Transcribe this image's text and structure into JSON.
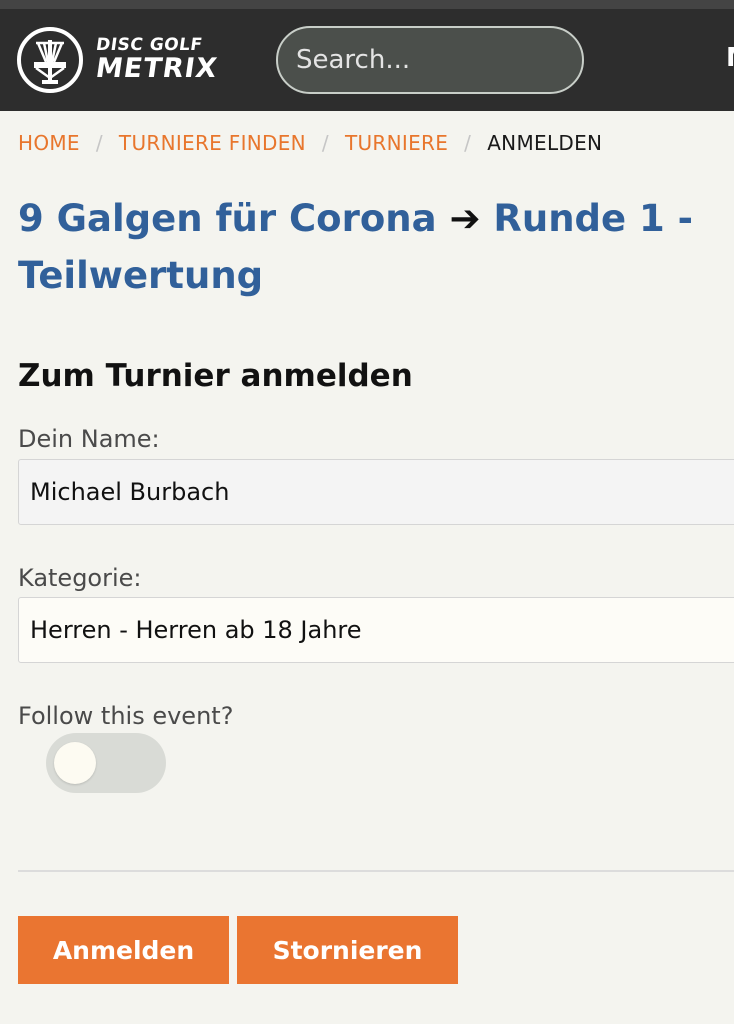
{
  "header": {
    "logo_line1": "DISC GOLF",
    "logo_line2": "METRIX",
    "search_placeholder": "Search...",
    "menu_peek": "M"
  },
  "breadcrumb": {
    "home": "HOME",
    "find": "TURNIERE FINDEN",
    "tournaments": "TURNIERE",
    "current": "ANMELDEN",
    "separator": "/"
  },
  "page": {
    "title_event": "9 Galgen für Corona",
    "title_arrow": "➔",
    "title_round": "Runde 1 - Teilwertung"
  },
  "form": {
    "heading": "Zum Turnier anmelden",
    "name_label": "Dein Name:",
    "name_value": "Michael Burbach",
    "category_label": "Kategorie:",
    "category_value": "Herren - Herren ab 18 Jahre",
    "follow_label": "Follow this event?",
    "follow_on": false
  },
  "actions": {
    "register": "Anmelden",
    "cancel": "Stornieren"
  },
  "colors": {
    "nav_bg": "#2d2d2d",
    "accent_orange": "#ea7531",
    "title_blue": "#31609a",
    "page_bg": "#f4f4ef"
  }
}
